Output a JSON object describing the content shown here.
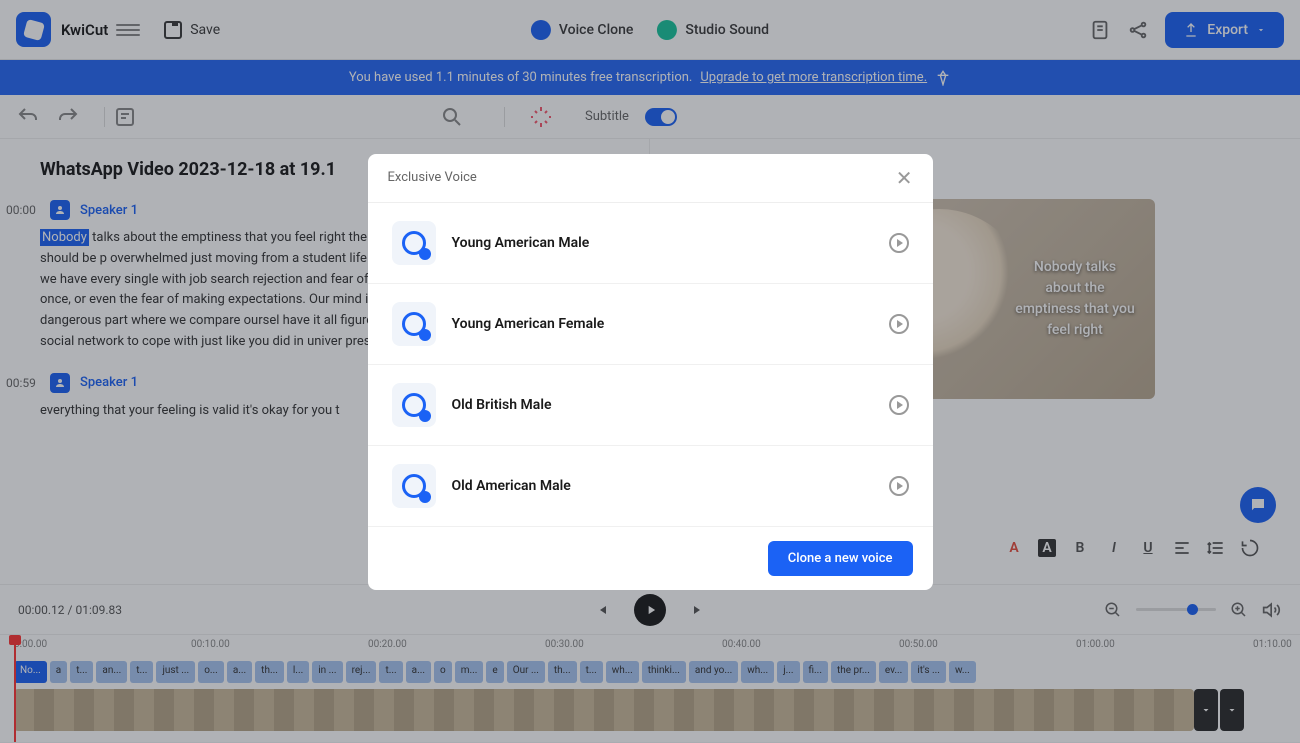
{
  "app": {
    "name": "KwiCut",
    "save_label": "Save"
  },
  "header_center": {
    "voice_clone": "Voice Clone",
    "studio_sound": "Studio Sound"
  },
  "export_label": "Export",
  "banner": {
    "text": "You have used 1.1 minutes of 30 minutes free transcription.",
    "link": "Upgrade to get more transcription time."
  },
  "subtitle_label": "Subtitle",
  "video_title": "WhatsApp Video 2023-12-18 at 19.1",
  "transcript": [
    {
      "time": "00:00",
      "speaker": "Speaker 1",
      "highlight": "Nobody",
      "text": " talks about the emptiness that you feel right the future and then what career path you should be p overwhelmed just moving from a student life to the re missing the familiar routine that we have every single with job search rejection and fear of being rejected t after being rejected once, or even the fear of making expectations. Our mind is said to think that if we mak comes the dangerous part where we compare oursel have it all figured out and you can also feel loneliness social network to cope with just like you did in univer pressure to become financially independent"
    },
    {
      "time": "00:59",
      "speaker": "Speaker 1",
      "text": "everything that your feeling is valid it's okay for you t"
    }
  ],
  "preview_subtitle": "Nobody talks about the emptiness that you feel right",
  "player": {
    "current": "00:00.12",
    "total": "01:09.83"
  },
  "ruler": [
    "0:00.00",
    "00:10.00",
    "00:20.00",
    "00:30.00",
    "00:40.00",
    "00:50.00",
    "01:00.00",
    "01:10.00"
  ],
  "words": [
    "No...",
    "a",
    "t...",
    "an...",
    "t...",
    "just ...",
    "o...",
    "a...",
    "th...",
    "l...",
    "in ...",
    "rej...",
    "t...",
    "a...",
    "o",
    "m...",
    "e",
    "Our ...",
    "th...",
    "t...",
    "wh...",
    "thinki...",
    "and yo...",
    "wh...",
    "j...",
    "fi...",
    "the pr...",
    "ev...",
    "it's ...",
    "w..."
  ],
  "modal": {
    "title": "Exclusive Voice",
    "voices": [
      {
        "name": "Young American Male"
      },
      {
        "name": "Young American Female"
      },
      {
        "name": "Old British Male"
      },
      {
        "name": "Old American Male"
      }
    ],
    "clone_btn": "Clone a new voice"
  }
}
